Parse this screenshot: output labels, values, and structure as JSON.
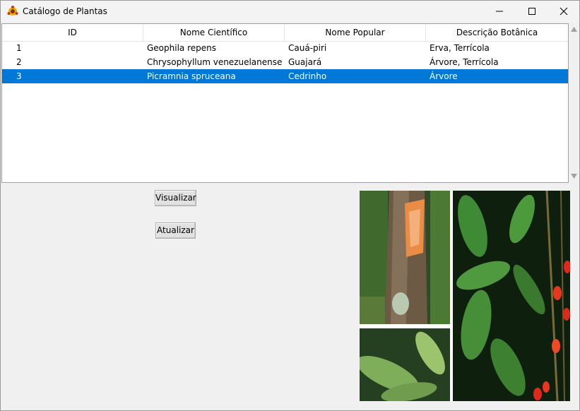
{
  "window": {
    "title": "Catálogo de Plantas"
  },
  "table": {
    "columns": [
      "ID",
      "Nome Científico",
      "Nome Popular",
      "Descrição Botânica"
    ],
    "rows": [
      [
        "1",
        "Geophila repens",
        "Cauá-piri",
        "Erva, Terrícola"
      ],
      [
        "2",
        "Chrysophyllum venezuelanense",
        "Guajará",
        "Árvore, Terrícola"
      ],
      [
        "3",
        "Picramnia spruceana",
        "Cedrinho",
        "Árvore"
      ]
    ],
    "selected_index": 2
  },
  "buttons": {
    "view": "Visualizar",
    "update": "Atualizar"
  },
  "colors": {
    "selection": "#0078d7",
    "background": "#f0f0f0"
  },
  "icons": {
    "app": "plant-app-icon",
    "minimize": "minimize-icon",
    "maximize": "maximize-icon",
    "close": "close-icon"
  }
}
